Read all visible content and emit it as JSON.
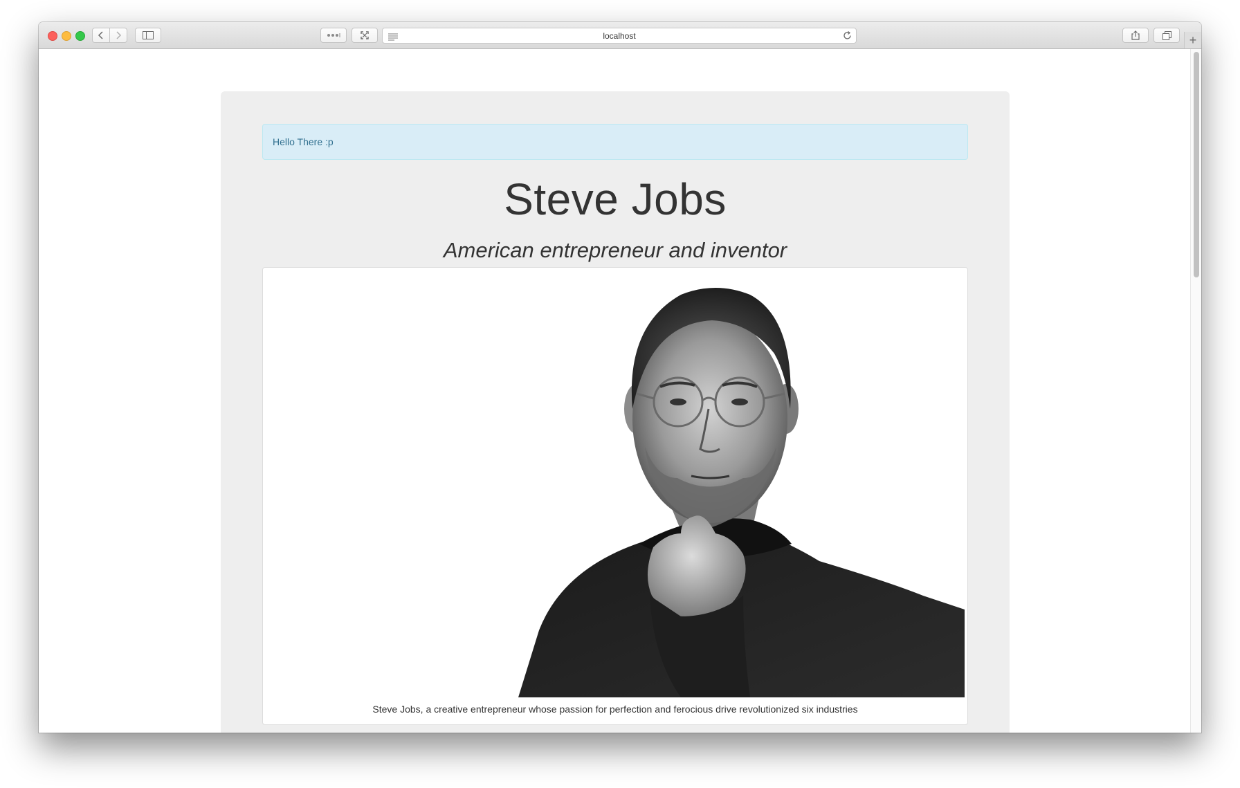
{
  "browser": {
    "url": "localhost"
  },
  "page": {
    "alert_text": "Hello There :p",
    "title": "Steve Jobs",
    "subtitle": "American entrepreneur and inventor",
    "caption": "Steve Jobs, a creative entrepreneur whose passion for perfection and ferocious drive revolutionized six industries"
  },
  "colors": {
    "jumbotron_bg": "#eeeeee",
    "alert_bg": "#d9edf7",
    "alert_text": "#31708f",
    "heading_text": "#333333"
  }
}
